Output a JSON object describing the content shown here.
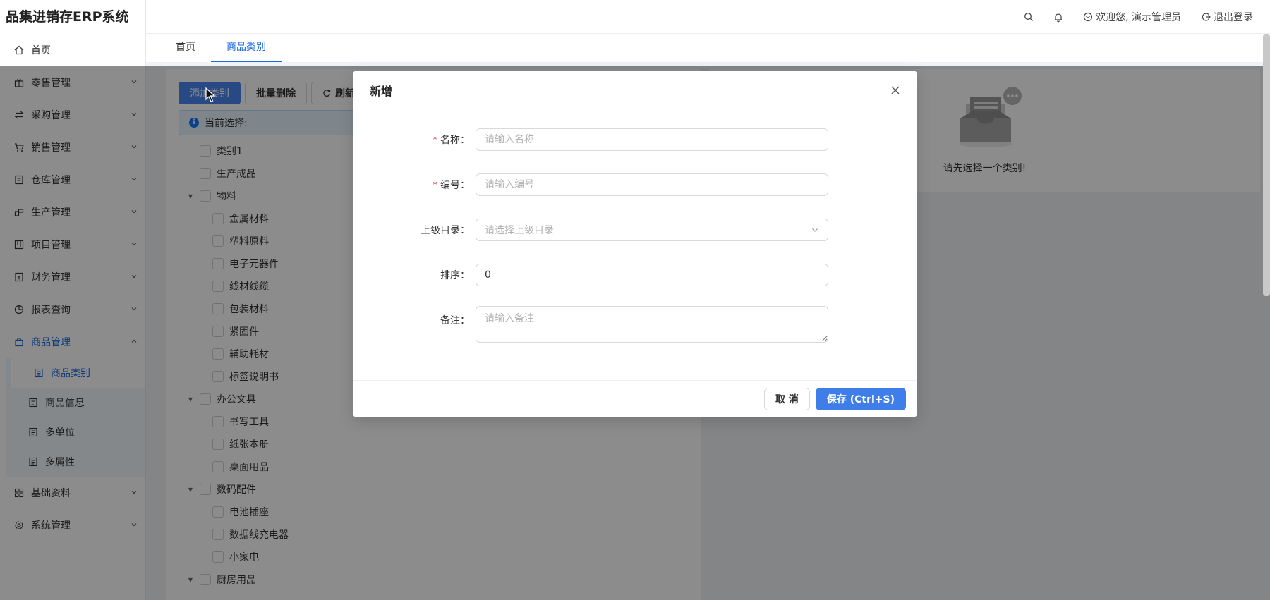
{
  "app": {
    "title": "品集进销存ERP系统"
  },
  "header": {
    "search_icon": "search-icon",
    "bell_icon": "bell-icon",
    "welcome": "欢迎您, 演示管理员",
    "logout": "退出登录"
  },
  "sidebar": {
    "items": [
      {
        "label": "首页",
        "icon": "home-icon"
      },
      {
        "label": "零售管理",
        "icon": "gift-icon"
      },
      {
        "label": "采购管理",
        "icon": "swap-icon"
      },
      {
        "label": "销售管理",
        "icon": "cart-icon"
      },
      {
        "label": "仓库管理",
        "icon": "warehouse-icon"
      },
      {
        "label": "生产管理",
        "icon": "production-icon"
      },
      {
        "label": "项目管理",
        "icon": "project-icon"
      },
      {
        "label": "财务管理",
        "icon": "finance-icon"
      },
      {
        "label": "报表查询",
        "icon": "chart-icon"
      },
      {
        "label": "商品管理",
        "icon": "bag-icon"
      },
      {
        "label": "基础资料",
        "icon": "grid-icon"
      },
      {
        "label": "系统管理",
        "icon": "gear-icon"
      }
    ],
    "submenu": [
      {
        "label": "商品类别"
      },
      {
        "label": "商品信息"
      },
      {
        "label": "多单位"
      },
      {
        "label": "多属性"
      }
    ]
  },
  "tabs": [
    {
      "label": "首页"
    },
    {
      "label": "商品类别"
    }
  ],
  "toolbar": {
    "add": "添加类别",
    "batch_delete": "批量删除",
    "refresh": "刷新"
  },
  "info": {
    "current_selection": "当前选择:"
  },
  "tree": [
    {
      "label": "类别1",
      "level": 0,
      "expanded": false,
      "has_children": false
    },
    {
      "label": "生产成品",
      "level": 0,
      "has_children": false
    },
    {
      "label": "物料",
      "level": 0,
      "has_children": true
    },
    {
      "label": "金属材料",
      "level": 1
    },
    {
      "label": "塑料原料",
      "level": 1
    },
    {
      "label": "电子元器件",
      "level": 1
    },
    {
      "label": "线材线缆",
      "level": 1
    },
    {
      "label": "包装材料",
      "level": 1
    },
    {
      "label": "紧固件",
      "level": 1
    },
    {
      "label": "辅助耗材",
      "level": 1
    },
    {
      "label": "标签说明书",
      "level": 1
    },
    {
      "label": "办公文具",
      "level": 0,
      "has_children": true
    },
    {
      "label": "书写工具",
      "level": 1
    },
    {
      "label": "纸张本册",
      "level": 1
    },
    {
      "label": "桌面用品",
      "level": 1
    },
    {
      "label": "数码配件",
      "level": 0,
      "has_children": true
    },
    {
      "label": "电池插座",
      "level": 1
    },
    {
      "label": "数据线充电器",
      "level": 1
    },
    {
      "label": "小家电",
      "level": 1
    },
    {
      "label": "厨房用品",
      "level": 0,
      "has_children": true
    }
  ],
  "right_panel": {
    "empty_text": "请先选择一个类别!"
  },
  "modal": {
    "title": "新增",
    "fields": {
      "name": {
        "label": "名称",
        "placeholder": "请输入名称",
        "required": true
      },
      "code": {
        "label": "编号",
        "placeholder": "请输入编号",
        "required": true
      },
      "parent": {
        "label": "上级目录",
        "placeholder": "请选择上级目录"
      },
      "sort": {
        "label": "排序",
        "value": "0"
      },
      "remark": {
        "label": "备注",
        "placeholder": "请输入备注"
      }
    },
    "cancel": "取 消",
    "save": "保存 (Ctrl+S)"
  },
  "colors": {
    "accent": "#1b6ae0",
    "primary_button": "#3f7ee8",
    "required": "#e5484d"
  }
}
